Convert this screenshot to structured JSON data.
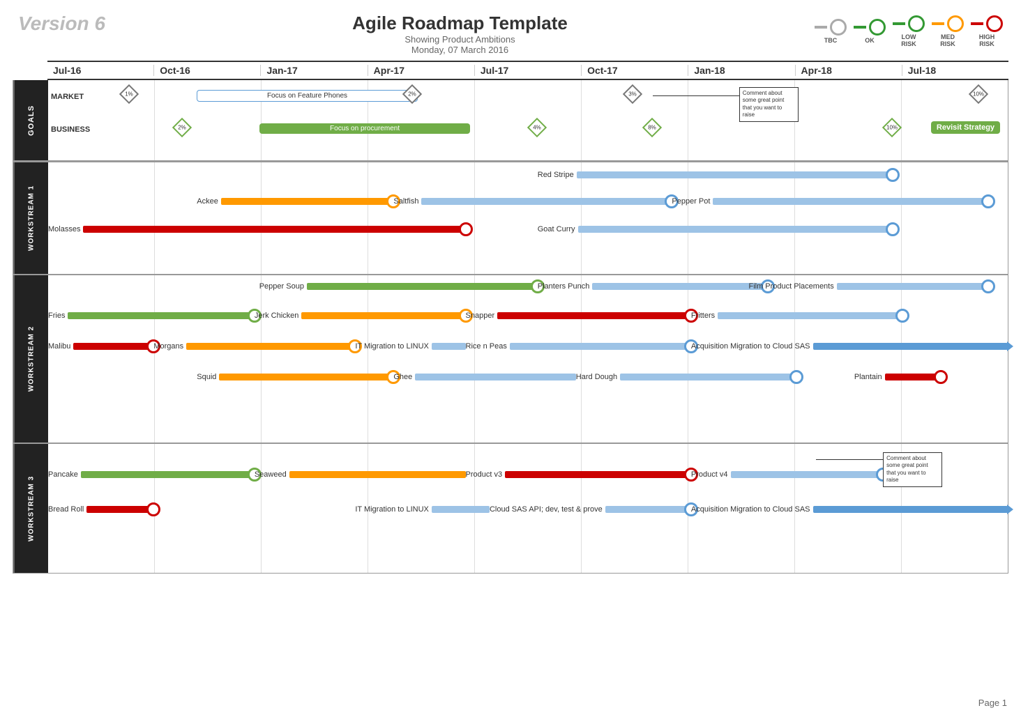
{
  "header": {
    "version": "Version 6",
    "title": "Agile Roadmap Template",
    "subtitle": "Showing Product Ambitions",
    "date": "Monday, 07 March 2016"
  },
  "legend": {
    "items": [
      {
        "label": "TBC",
        "type": "tbc"
      },
      {
        "label": "OK",
        "type": "ok"
      },
      {
        "label": "LOW\nRISK",
        "type": "low-risk"
      },
      {
        "label": "MED\nRISK",
        "type": "med-risk"
      },
      {
        "label": "HIGH\nRISK",
        "type": "high-risk"
      }
    ]
  },
  "timeline": {
    "months": [
      "Jul-16",
      "Oct-16",
      "Jan-17",
      "Apr-17",
      "Jul-17",
      "Oct-17",
      "Jan-18",
      "Apr-18",
      "Jul-18"
    ]
  },
  "goals": {
    "label": "GOALS",
    "market_label": "MARKET",
    "business_label": "BUSINESS",
    "milestones": [
      {
        "text": "1%",
        "position": 0.08
      },
      {
        "text": "2%",
        "position": 0.38
      },
      {
        "text": "3%",
        "position": 0.61
      },
      {
        "text": "10%",
        "position": 0.97
      }
    ],
    "business_milestones": [
      {
        "text": "2%",
        "position": 0.14
      },
      {
        "text": "4%",
        "position": 0.51
      },
      {
        "text": "8%",
        "position": 0.63
      },
      {
        "text": "10%",
        "position": 0.88
      }
    ],
    "focus_feature_phones": {
      "label": "Focus on Feature Phones",
      "start": 0.155,
      "end": 0.38
    },
    "focus_procurement": {
      "label": "Focus on procurement",
      "start": 0.22,
      "end": 0.435
    },
    "revisit_strategy": {
      "label": "Revisit Strategy"
    },
    "comment": "Comment about some great point that you want to raise"
  },
  "workstream1": {
    "label": "WORKSTREAM 1",
    "items": [
      {
        "name": "Red Stripe",
        "color": "lightblue",
        "start": 0.51,
        "end": 0.88,
        "milestone_pos": 0.88
      },
      {
        "name": "Ackee",
        "color": "orange",
        "start": 0.155,
        "end": 0.36,
        "milestone_pos": 0.36
      },
      {
        "name": "Saltfish",
        "color": "lightblue",
        "start": 0.36,
        "end": 0.65,
        "milestone_pos": 0.65
      },
      {
        "name": "Pepper Pot",
        "color": "lightblue",
        "start": 0.65,
        "end": 1.0,
        "milestone_pos": 1.0
      },
      {
        "name": "Molasses",
        "color": "red",
        "start": 0.0,
        "end": 0.435,
        "milestone_pos": 0.435
      },
      {
        "name": "Goat Curry",
        "color": "lightblue",
        "start": 0.51,
        "end": 0.88,
        "milestone_pos": 0.88
      }
    ]
  },
  "workstream2": {
    "label": "WORKSTREAM 2",
    "items": [
      {
        "name": "Pepper Soup",
        "color": "green",
        "start": 0.22,
        "end": 0.51,
        "milestone_pos": 0.51
      },
      {
        "name": "Planters Punch",
        "color": "lightblue",
        "start": 0.51,
        "end": 0.75,
        "milestone_pos": 0.75
      },
      {
        "name": "Film Product Placements",
        "color": "lightblue",
        "start": 0.735,
        "end": 1.0,
        "milestone_pos": 1.0
      },
      {
        "name": "Fries",
        "color": "green",
        "start": 0.0,
        "end": 0.215,
        "milestone_pos": 0.215
      },
      {
        "name": "Jerk Chicken",
        "color": "orange",
        "start": 0.215,
        "end": 0.435,
        "milestone_pos": 0.435
      },
      {
        "name": "Snapper",
        "color": "red",
        "start": 0.435,
        "end": 0.67,
        "milestone_pos": 0.67
      },
      {
        "name": "Fritters",
        "color": "lightblue",
        "start": 0.67,
        "end": 0.89,
        "milestone_pos": 0.89
      },
      {
        "name": "Malibu",
        "color": "red",
        "start": 0.0,
        "end": 0.11,
        "milestone_pos": 0.11
      },
      {
        "name": "Morgans",
        "color": "orange",
        "start": 0.11,
        "end": 0.32,
        "milestone_pos": 0.32
      },
      {
        "name": "IT Migration to LINUX",
        "color": "lightblue",
        "start": 0.32,
        "end": 0.435
      },
      {
        "name": "Rice n Peas",
        "color": "lightblue",
        "start": 0.435,
        "end": 0.67,
        "milestone_pos": 0.67
      },
      {
        "name": "Acquisition Migration to Cloud SAS",
        "color": "blue",
        "start": 0.67,
        "end": 1.0,
        "arrow": true
      },
      {
        "name": "Squid",
        "color": "orange",
        "start": 0.155,
        "end": 0.36,
        "milestone_pos": 0.36
      },
      {
        "name": "Ghee",
        "color": "lightblue",
        "start": 0.36,
        "end": 0.55
      },
      {
        "name": "Hard Dough",
        "color": "lightblue",
        "start": 0.55,
        "end": 0.78,
        "milestone_pos": 0.78
      },
      {
        "name": "Plantain",
        "color": "red",
        "start": 0.84,
        "end": 0.93,
        "milestone_pos": 0.93
      }
    ]
  },
  "workstream3": {
    "label": "WORKSTREAM 3",
    "items": [
      {
        "name": "Pancake",
        "color": "green",
        "start": 0.0,
        "end": 0.215,
        "milestone_pos": 0.215
      },
      {
        "name": "Seaweed",
        "color": "orange",
        "start": 0.215,
        "end": 0.435
      },
      {
        "name": "Product v3",
        "color": "red",
        "start": 0.435,
        "end": 0.67,
        "milestone_pos": 0.67
      },
      {
        "name": "Product v4",
        "color": "lightblue",
        "start": 0.67,
        "end": 0.87,
        "milestone_pos": 0.87
      },
      {
        "name": "Bread Roll",
        "color": "red",
        "start": 0.0,
        "end": 0.11,
        "milestone_pos": 0.11
      },
      {
        "name": "IT Migration to LINUX",
        "color": "lightblue",
        "start": 0.32,
        "end": 0.46
      },
      {
        "name": "Cloud SAS API; dev, test & prove",
        "color": "lightblue",
        "start": 0.46,
        "end": 0.67,
        "milestone_pos": 0.67
      },
      {
        "name": "Acquisition Migration to Cloud SAS",
        "color": "blue",
        "start": 0.67,
        "end": 1.0,
        "arrow": true
      }
    ]
  },
  "page": {
    "number": "Page 1"
  }
}
